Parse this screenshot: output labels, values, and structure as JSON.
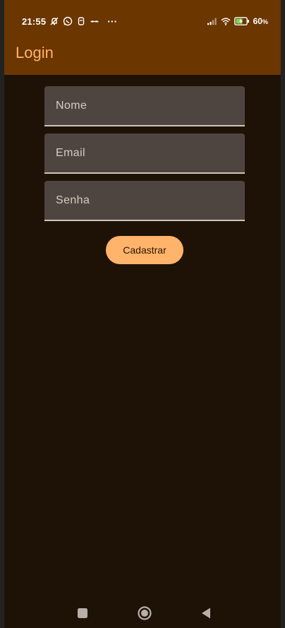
{
  "status_bar": {
    "time": "21:55",
    "battery": "60",
    "battery_unit": "%",
    "overflow": "···",
    "icons": [
      "notifications-off-icon",
      "whatsapp-icon",
      "storage-icon",
      "mustache-icon",
      "signal-icon",
      "wifi-icon",
      "battery-charging-icon"
    ]
  },
  "app_bar": {
    "title": "Login"
  },
  "form": {
    "name_placeholder": "Nome",
    "email_placeholder": "Email",
    "password_placeholder": "Senha",
    "name_value": "",
    "email_value": "",
    "password_value": ""
  },
  "actions": {
    "register_label": "Cadastrar"
  },
  "nav_bar": {
    "icons": [
      "recents-icon",
      "home-icon",
      "back-icon"
    ]
  },
  "colors": {
    "app_bar": "#6b3600",
    "background": "#1e1206",
    "title": "#ffb36b",
    "field_fill": "#4f4540",
    "button": "#ffb36b"
  }
}
